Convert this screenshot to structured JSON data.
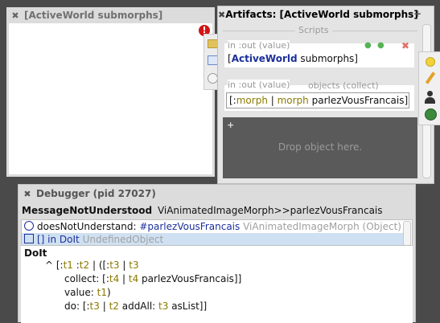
{
  "world_window": {
    "close_glyph": "✖",
    "title": "[ActiveWorld submorphs]"
  },
  "artifacts_window": {
    "close_glyph": "✖",
    "title": "Artifacts: [ActiveWorld submorphs]",
    "scripts_header": "Scripts",
    "script_port_label": "in :out (value)",
    "script_text_prefix": "[",
    "script_text_bold": "ActiveWorld",
    "script_text_rest": " submorphs]",
    "objects_header": "objects (collect)",
    "objects_port_label": "in :out (value)",
    "objects_parts": [
      "[:",
      "morph",
      " | ",
      "morph",
      " parlezVousFrancais]"
    ],
    "drop_hint": "Drop object here.",
    "add_glyph": "+"
  },
  "debugger": {
    "close_glyph": "✖",
    "title": "Debugger (pid 27027)",
    "error_label": "MessageNotUnderstood",
    "error_detail": "ViAnimatedImageMorph>>parlezVousFrancais",
    "stack": [
      {
        "method": "doesNotUnderstand:",
        "arg": "#parlezVousFrancais",
        "receiver": "ViAnimatedImageMorph (Object)"
      },
      {
        "method": "[] in DoIt",
        "receiver": "UndefinedObject"
      }
    ],
    "code_title": "DoIt",
    "code_lines": [
      [
        "^ [:",
        "t1",
        " :",
        "t2",
        " | ([:",
        "t3",
        " | ",
        "t3"
      ],
      [
        "collect: [:",
        "t4",
        " | ",
        "t4",
        " parlezVousFrancais]]"
      ],
      [
        "value: ",
        "t1",
        ")"
      ],
      [
        "do: [:",
        "t3",
        " | ",
        "t2",
        " addAll: ",
        "t3",
        " asList]]"
      ]
    ]
  },
  "colors": {
    "background": "#4a4a4a",
    "accent_blue": "#1c2f9a",
    "var_olive": "#8a7a00",
    "selection": "#cfe0f2",
    "error_red": "#d21414"
  }
}
